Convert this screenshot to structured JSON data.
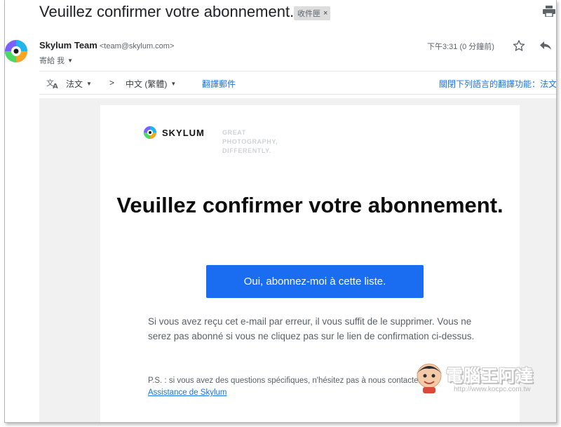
{
  "header": {
    "subject": "Veuillez confirmer votre abonnement.",
    "label_chip": "收件匣",
    "label_remove": "×"
  },
  "sender": {
    "name": "Skylum Team",
    "email": "<team@skylum.com>",
    "recipient": "寄給 我",
    "time": "下午3:31 (0 分鐘前)"
  },
  "translate_bar": {
    "source_lang": "法文",
    "arrow": ">",
    "target_lang": "中文 (繁體)",
    "translate_link": "翻譯郵件",
    "disable_link": "關閉下列語言的翻譯功能：法文"
  },
  "email": {
    "brand_name": "SKYLUM",
    "tagline": "GREAT\nPHOTOGRAPHY,\nDIFFERENTLY.",
    "headline": "Veuillez confirmer votre abonnement.",
    "cta_label": "Oui, abonnez-moi à cette liste.",
    "body": "Si vous avez reçu cet e-mail par erreur, il vous suffit de le supprimer. Vous ne serez pas abonné si vous ne cliquez pas sur le lien de confirmation ci-dessus.",
    "ps": "P.S. : si vous avez des questions spécifiques, n'hésitez pas à nous contacter via",
    "support_link": "Assistance de Skylum"
  },
  "watermark": {
    "text": "電腦王阿達",
    "url": "http://www.kocpc.com.tw"
  },
  "colors": {
    "cta": "#1a6cf0",
    "link": "#1a73e8",
    "email_background": "#f1f1f1"
  }
}
